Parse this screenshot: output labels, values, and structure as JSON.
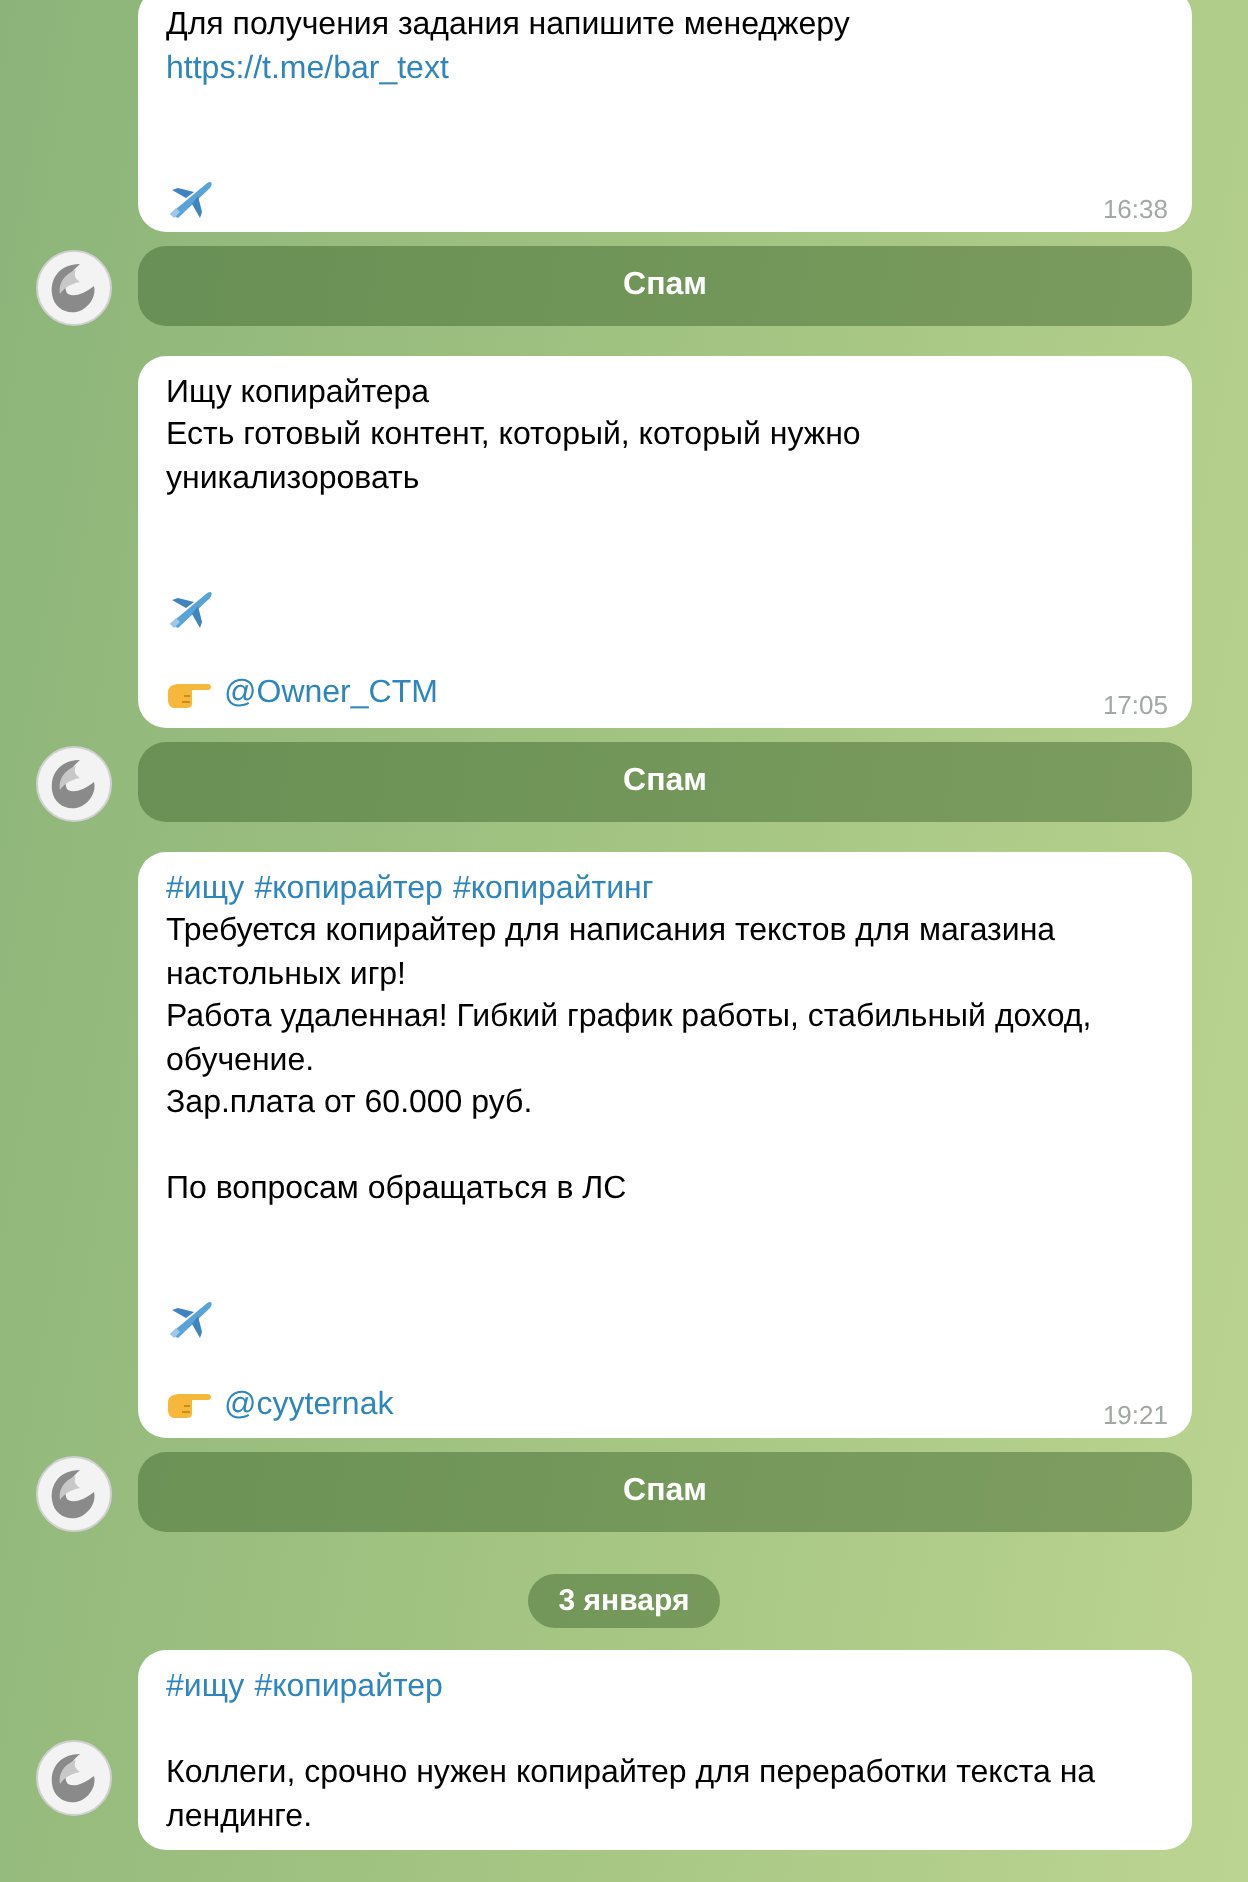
{
  "messages": [
    {
      "blocks": [
        {
          "kind": "line",
          "parts": [
            {
              "kind": "text",
              "text": "Для получения задания напишите менеджеру"
            }
          ]
        },
        {
          "kind": "line",
          "parts": [
            {
              "kind": "link",
              "text": "https://t.me/bar_text"
            }
          ]
        },
        {
          "kind": "blank"
        },
        {
          "kind": "blank"
        },
        {
          "kind": "plane"
        }
      ],
      "time": "16:38",
      "button": "Спам"
    },
    {
      "blocks": [
        {
          "kind": "line",
          "parts": [
            {
              "kind": "text",
              "text": "Ищу копирайтера"
            }
          ]
        },
        {
          "kind": "line",
          "parts": [
            {
              "kind": "text",
              "text": "Есть готовый контент, который, который нужно"
            }
          ]
        },
        {
          "kind": "line",
          "parts": [
            {
              "kind": "text",
              "text": "уникализоровать"
            }
          ]
        },
        {
          "kind": "blank"
        },
        {
          "kind": "blank"
        },
        {
          "kind": "plane"
        },
        {
          "kind": "blank"
        },
        {
          "kind": "mention",
          "text": "@Owner_CTM"
        }
      ],
      "time": "17:05",
      "button": "Спам"
    },
    {
      "blocks": [
        {
          "kind": "line",
          "parts": [
            {
              "kind": "hashtag",
              "text": "#ищу"
            },
            {
              "kind": "hashtag",
              "text": "#копирайтер"
            },
            {
              "kind": "hashtag",
              "text": "#копирайтинг"
            }
          ]
        },
        {
          "kind": "line",
          "parts": [
            {
              "kind": "text",
              "text": "Требуется копирайтер для написания текстов для магазина"
            }
          ]
        },
        {
          "kind": "line",
          "parts": [
            {
              "kind": "text",
              "text": "настольных игр!"
            }
          ]
        },
        {
          "kind": "line",
          "parts": [
            {
              "kind": "text",
              "text": "Работа удаленная! Гибкий график работы, стабильный доход,"
            }
          ]
        },
        {
          "kind": "line",
          "parts": [
            {
              "kind": "text",
              "text": "обучение."
            }
          ]
        },
        {
          "kind": "line",
          "parts": [
            {
              "kind": "text",
              "text": "Зар.плата от 60.000 руб."
            }
          ]
        },
        {
          "kind": "blank"
        },
        {
          "kind": "line",
          "parts": [
            {
              "kind": "text",
              "text": "По вопросам обращаться в ЛС"
            }
          ]
        },
        {
          "kind": "blank"
        },
        {
          "kind": "blank"
        },
        {
          "kind": "plane"
        },
        {
          "kind": "blank"
        },
        {
          "kind": "mention",
          "text": "@cyyternak"
        }
      ],
      "time": "19:21",
      "button": "Спам"
    },
    {
      "date": "3 января",
      "blocks": [
        {
          "kind": "line",
          "parts": [
            {
              "kind": "hashtag",
              "text": "#ищу"
            },
            {
              "kind": "hashtag",
              "text": "#копирайтер"
            }
          ]
        },
        {
          "kind": "blank"
        },
        {
          "kind": "line",
          "parts": [
            {
              "kind": "text",
              "text": "Коллеги, срочно нужен копирайтер для переработки текста на"
            }
          ]
        },
        {
          "kind": "line",
          "parts": [
            {
              "kind": "text",
              "text": "лендинге."
            }
          ]
        }
      ]
    }
  ]
}
